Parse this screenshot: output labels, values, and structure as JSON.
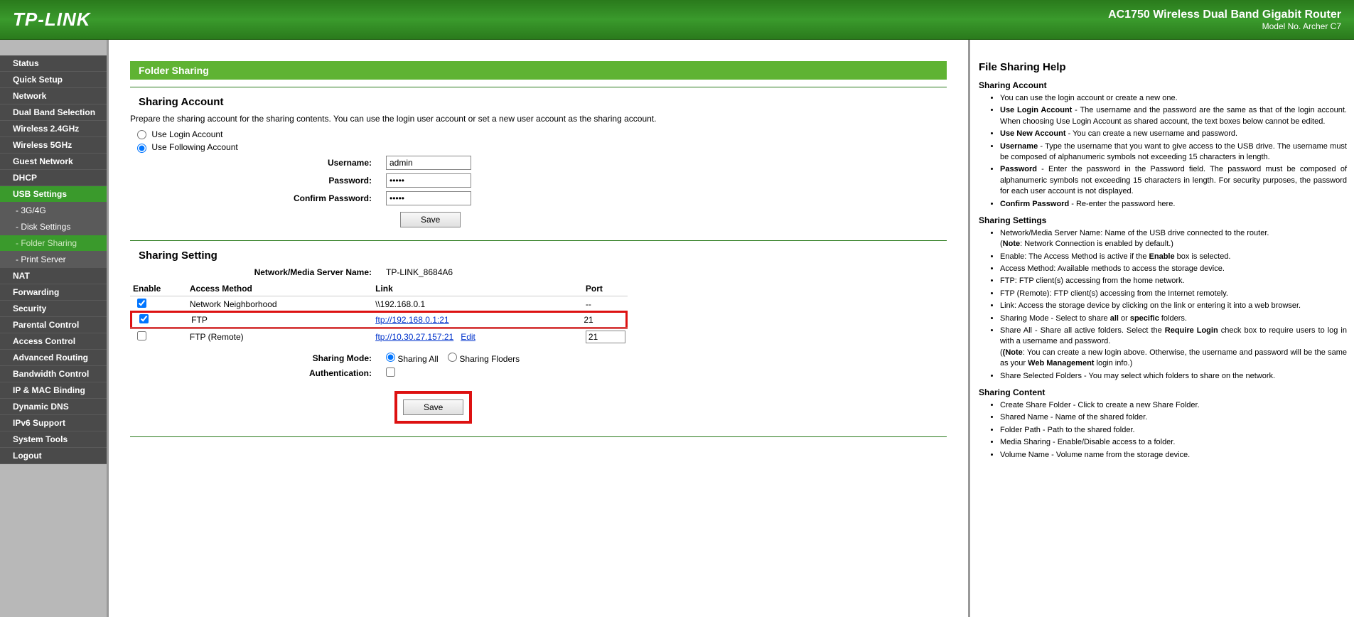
{
  "header": {
    "logo": "TP-LINK",
    "product": "AC1750 Wireless Dual Band Gigabit Router",
    "model": "Model No. Archer C7"
  },
  "nav": {
    "items": [
      {
        "label": "Status"
      },
      {
        "label": "Quick Setup"
      },
      {
        "label": "Network"
      },
      {
        "label": "Dual Band Selection"
      },
      {
        "label": "Wireless 2.4GHz"
      },
      {
        "label": "Wireless 5GHz"
      },
      {
        "label": "Guest Network"
      },
      {
        "label": "DHCP"
      },
      {
        "label": "USB Settings",
        "active": true
      },
      {
        "label": "- 3G/4G",
        "sub": true
      },
      {
        "label": "- Disk Settings",
        "sub": true
      },
      {
        "label": "- Folder Sharing",
        "sub": true,
        "active": true
      },
      {
        "label": "- Print Server",
        "sub": true
      },
      {
        "label": "NAT"
      },
      {
        "label": "Forwarding"
      },
      {
        "label": "Security"
      },
      {
        "label": "Parental Control"
      },
      {
        "label": "Access Control"
      },
      {
        "label": "Advanced Routing"
      },
      {
        "label": "Bandwidth Control"
      },
      {
        "label": "IP & MAC Binding"
      },
      {
        "label": "Dynamic DNS"
      },
      {
        "label": "IPv6 Support"
      },
      {
        "label": "System Tools"
      },
      {
        "label": "Logout"
      }
    ]
  },
  "page": {
    "title": "Folder Sharing",
    "account": {
      "heading": "Sharing Account",
      "hint": "Prepare the sharing account for the sharing contents. You can use the login user account or set a new user account as the sharing account.",
      "opt_login": "Use Login Account",
      "opt_following": "Use Following Account",
      "lbl_username": "Username:",
      "lbl_password": "Password:",
      "lbl_confirm": "Confirm Password:",
      "username": "admin",
      "password": "•••••",
      "confirm": "•••••",
      "save": "Save"
    },
    "setting": {
      "heading": "Sharing Setting",
      "lbl_server": "Network/Media Server Name:",
      "server_name": "TP-LINK_8684A6",
      "th_enable": "Enable",
      "th_method": "Access Method",
      "th_link": "Link",
      "th_port": "Port",
      "rows": [
        {
          "enabled": true,
          "method": "Network Neighborhood",
          "link": "\\\\192.168.0.1",
          "is_link": false,
          "port": "--"
        },
        {
          "enabled": true,
          "method": "FTP",
          "link": "ftp://192.168.0.1:21",
          "is_link": true,
          "port": "21",
          "highlight": true
        },
        {
          "enabled": false,
          "method": "FTP (Remote)",
          "link": "ftp://10.30.27.157:21",
          "is_link": true,
          "port": "21",
          "port_editable": true,
          "edit": "Edit"
        }
      ],
      "lbl_mode": "Sharing Mode:",
      "opt_all": "Sharing All",
      "opt_folders": "Sharing Floders",
      "lbl_auth": "Authentication:",
      "save": "Save"
    }
  },
  "help": {
    "title": "File Sharing Help",
    "s1": {
      "h": "Sharing Account",
      "i0": "You can use the login account or create a new one.",
      "i1a": "Use Login Account",
      "i1b": " - The username and the password are the same as that of the login account. When choosing Use Login Account as shared account, the text boxes below cannot be edited.",
      "i2a": "Use New Account",
      "i2b": " - You can create a new username and password.",
      "i3a": "Username",
      "i3b": " - Type the username that you want to give access to the USB drive. The username must be composed of alphanumeric symbols not exceeding 15 characters in length.",
      "i4a": "Password",
      "i4b": " - Enter the password in the Password field. The password must be composed of alphanumeric symbols not exceeding 15 characters in length. For security purposes, the password for each user account is not displayed.",
      "i5a": "Confirm Password",
      "i5b": " - Re-enter the password here."
    },
    "s2": {
      "h": "Sharing Settings",
      "i0": "Network/Media Server Name: Name of the USB drive connected to the router.",
      "i0n": "(Note: Network Connection is enabled by default.)",
      "i1a": "Enable: The Access Method is active if the ",
      "i1b": "Enable",
      "i1c": " box is selected.",
      "i2": "Access Method: Available methods to access the storage device.",
      "i3": "FTP: FTP client(s) accessing from the home network.",
      "i4": "FTP (Remote): FTP client(s) accessing from the Internet remotely.",
      "i5": "Link: Access the storage device by clicking on the link or entering it into a web browser.",
      "i6a": "Sharing Mode - Select to share ",
      "i6b": "all",
      "i6c": " or ",
      "i6d": "specific",
      "i6e": " folders.",
      "i7a": "Share All - Share all active folders. Select the ",
      "i7b": "Require Login",
      "i7c": " check box to require users to log in with a username and password.",
      "i7na": "(Note",
      "i7nb": ": You can create a new login above. Otherwise, the username and password will be the same as your ",
      "i7nc": "Web Management",
      "i7nd": " login info.)",
      "i8": "Share Selected Folders - You may select which folders to share on the network."
    },
    "s3": {
      "h": "Sharing Content",
      "i0": "Create Share Folder - Click to create a new Share Folder.",
      "i1": "Shared Name - Name of the shared folder.",
      "i2": "Folder Path - Path to the shared folder.",
      "i3": "Media Sharing - Enable/Disable access to a folder.",
      "i4": "Volume Name - Volume name from the storage device."
    }
  }
}
